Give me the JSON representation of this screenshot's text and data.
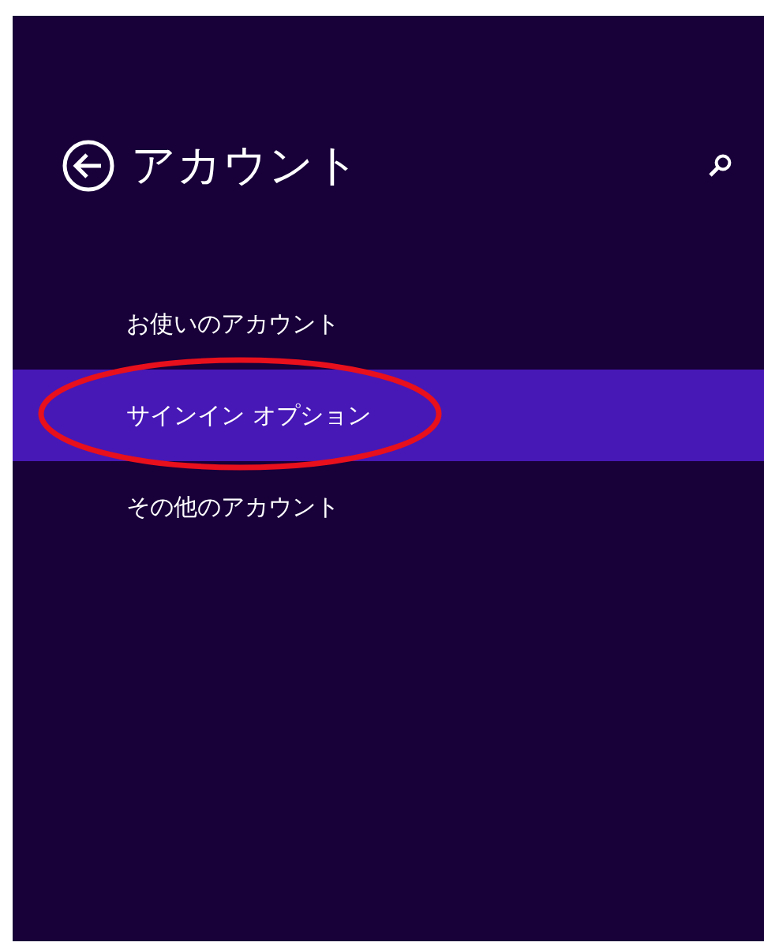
{
  "header": {
    "title": "アカウント"
  },
  "items": [
    {
      "label": "お使いのアカウント",
      "selected": false
    },
    {
      "label": "サインイン オプション",
      "selected": true,
      "circled": true
    },
    {
      "label": "その他のアカウント",
      "selected": false
    }
  ]
}
